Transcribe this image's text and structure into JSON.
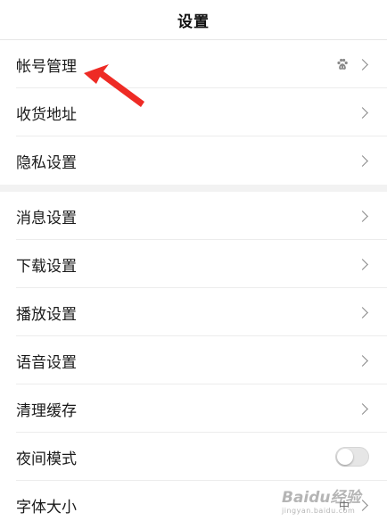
{
  "header": {
    "title": "设置"
  },
  "groups": [
    {
      "items": [
        {
          "label": "帐号管理",
          "has_badge": true,
          "badge_icon": "baidu-paw-icon"
        },
        {
          "label": "收货地址"
        },
        {
          "label": "隐私设置"
        }
      ]
    },
    {
      "items": [
        {
          "label": "消息设置"
        },
        {
          "label": "下载设置"
        },
        {
          "label": "播放设置"
        },
        {
          "label": "语音设置"
        },
        {
          "label": "清理缓存"
        },
        {
          "label": "夜间模式",
          "control": "toggle",
          "enabled": false
        },
        {
          "label": "字体大小",
          "value": "中"
        }
      ]
    }
  ],
  "annotation": {
    "color": "#ee2b25",
    "icon": "red-arrow-icon"
  },
  "watermark": {
    "text": "Baidu经验",
    "sub": "jingyan.baidu.com"
  }
}
